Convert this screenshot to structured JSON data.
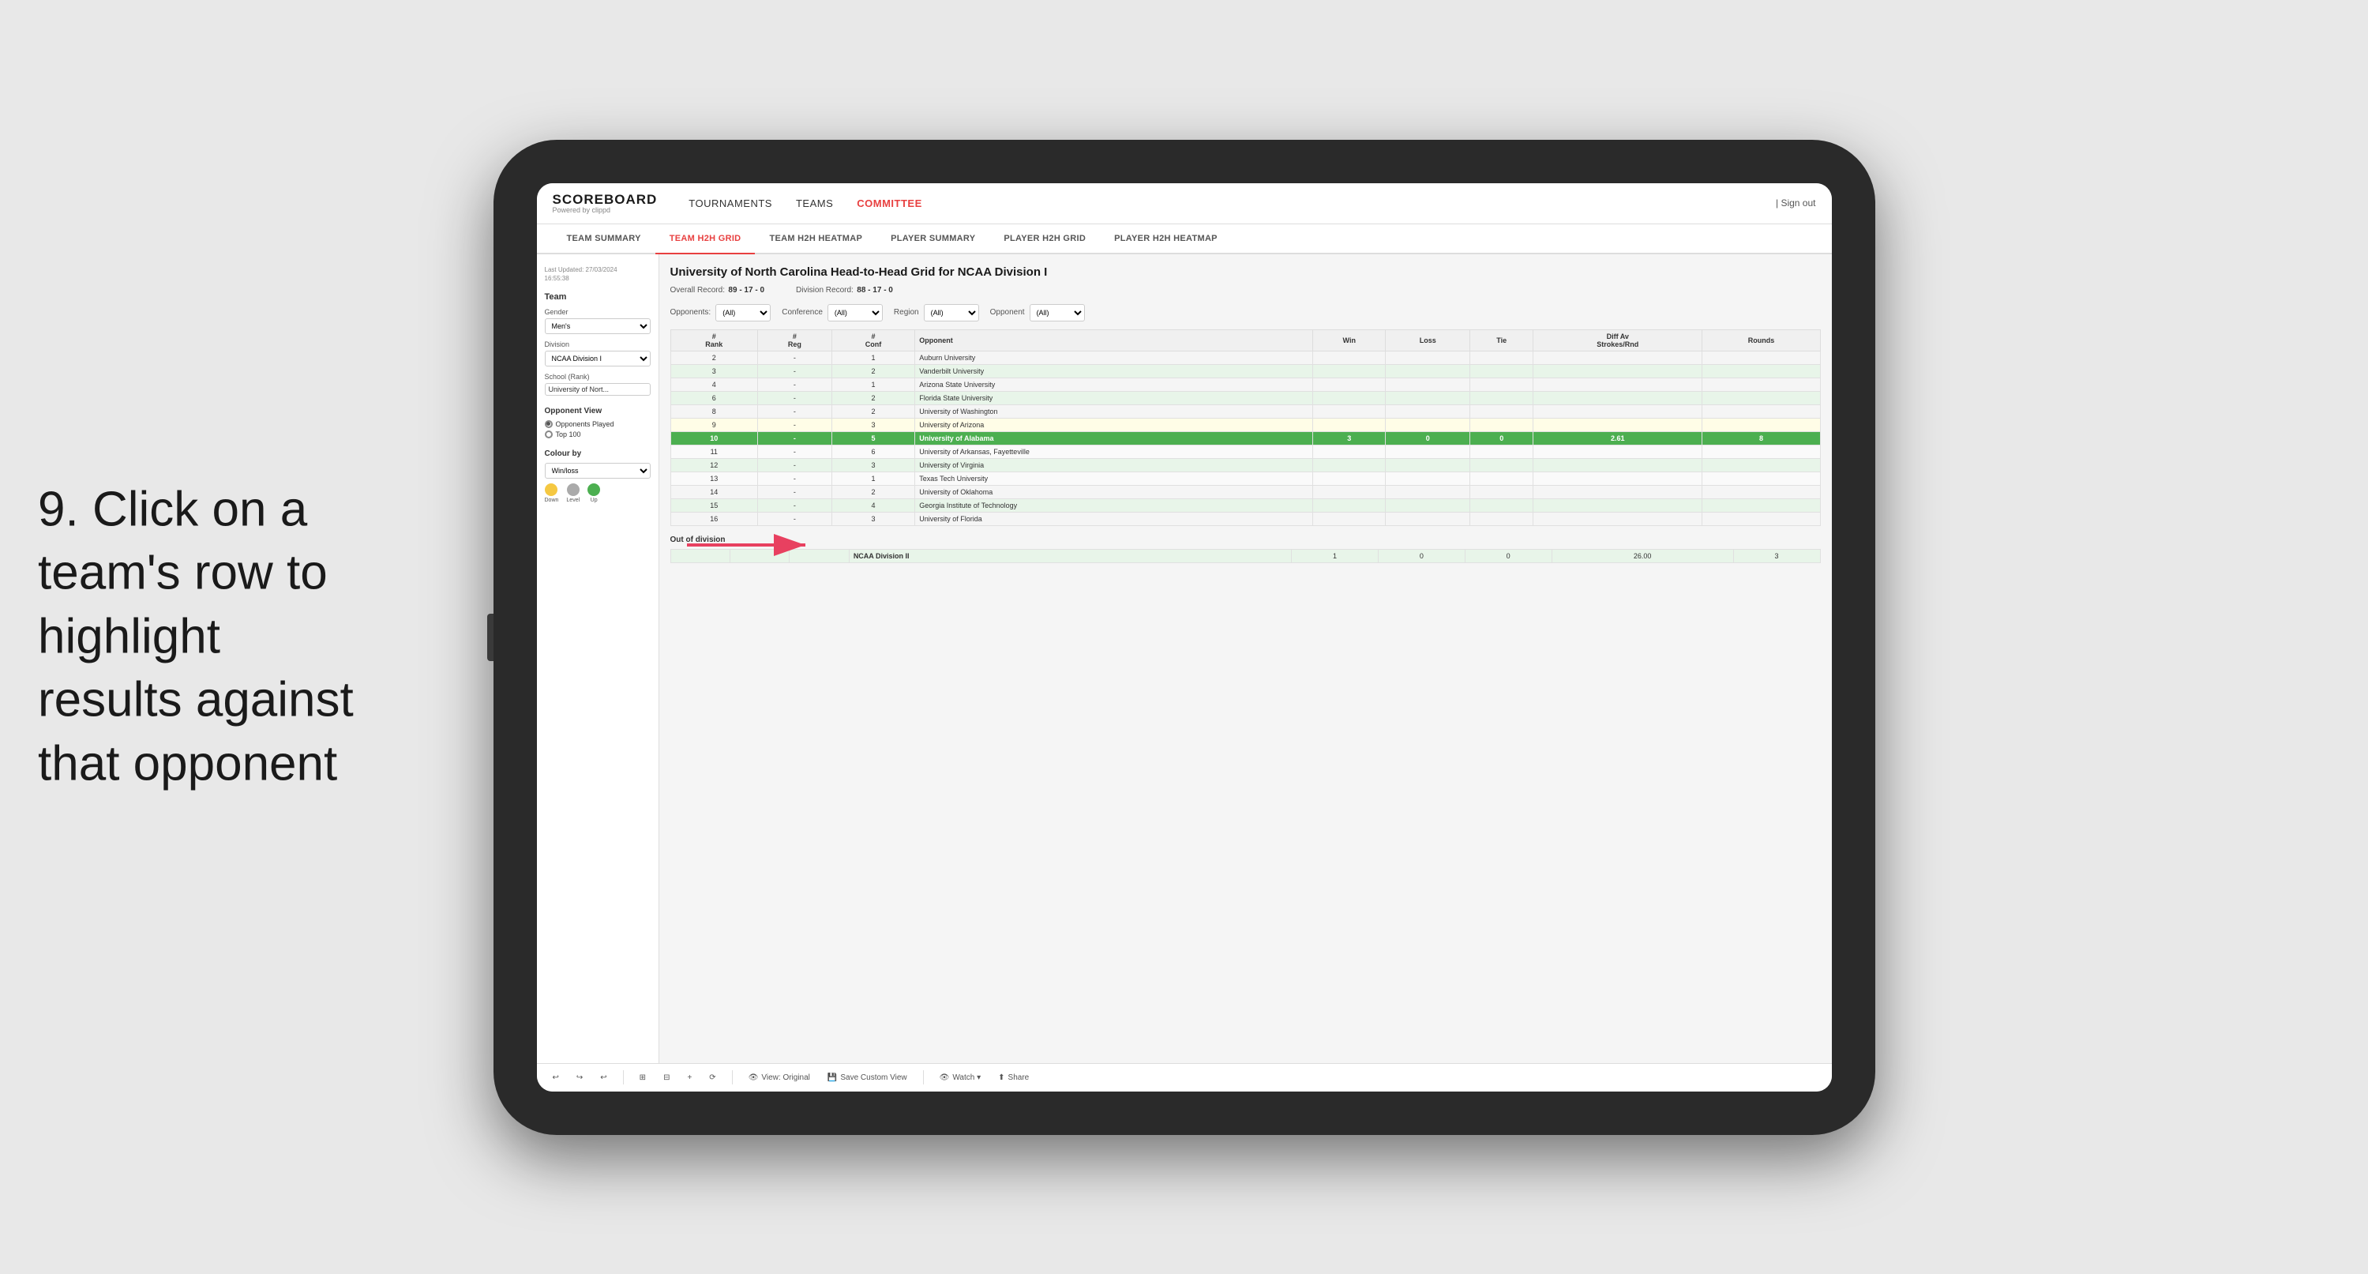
{
  "instruction": {
    "step": "9.",
    "text": "Click on a team's row to highlight results against that opponent"
  },
  "navbar": {
    "logo_title": "SCOREBOARD",
    "logo_sub": "Powered by clippd",
    "nav_tournaments": "TOURNAMENTS",
    "nav_teams": "TEAMS",
    "nav_committee": "COMMITTEE",
    "sign_out": "Sign out"
  },
  "subtabs": [
    {
      "label": "TEAM SUMMARY",
      "active": false
    },
    {
      "label": "TEAM H2H GRID",
      "active": true
    },
    {
      "label": "TEAM H2H HEATMAP",
      "active": false
    },
    {
      "label": "PLAYER SUMMARY",
      "active": false
    },
    {
      "label": "PLAYER H2H GRID",
      "active": false
    },
    {
      "label": "PLAYER H2H HEATMAP",
      "active": false
    }
  ],
  "sidebar": {
    "timestamp_label": "Last Updated: 27/03/2024",
    "timestamp_time": "16:55:38",
    "team_label": "Team",
    "gender_label": "Gender",
    "gender_value": "Men's",
    "division_label": "Division",
    "division_value": "NCAA Division I",
    "school_label": "School (Rank)",
    "school_value": "University of Nort...",
    "opponent_view_title": "Opponent View",
    "radio_opponents_played": "Opponents Played",
    "radio_top100": "Top 100",
    "colour_by_title": "Colour by",
    "colour_by_value": "Win/loss",
    "legend_down": "Down",
    "legend_level": "Level",
    "legend_up": "Up"
  },
  "report": {
    "title": "University of North Carolina Head-to-Head Grid for NCAA Division I",
    "overall_record_label": "Overall Record:",
    "overall_record_value": "89 - 17 - 0",
    "division_record_label": "Division Record:",
    "division_record_value": "88 - 17 - 0",
    "opponents_label": "Opponents:",
    "opponents_value": "(All)",
    "conference_label": "Conference",
    "conference_value": "(All)",
    "region_label": "Region",
    "region_value": "(All)",
    "opponent_label": "Opponent",
    "opponent_value": "(All)",
    "columns": {
      "rank": "#\nRank",
      "reg": "#\nReg",
      "conf": "#\nConf",
      "opponent": "Opponent",
      "win": "Win",
      "loss": "Loss",
      "tie": "Tie",
      "diff_av": "Diff Av\nStrokes/Rnd",
      "rounds": "Rounds"
    }
  },
  "table_rows": [
    {
      "rank": "2",
      "reg": "-",
      "conf": "1",
      "opponent": "Auburn University",
      "win": "",
      "loss": "",
      "tie": "",
      "diff": "",
      "rounds": "",
      "highlight": false,
      "row_class": ""
    },
    {
      "rank": "3",
      "reg": "-",
      "conf": "2",
      "opponent": "Vanderbilt University",
      "win": "",
      "loss": "",
      "tie": "",
      "diff": "",
      "rounds": "",
      "highlight": false,
      "row_class": "green-light"
    },
    {
      "rank": "4",
      "reg": "-",
      "conf": "1",
      "opponent": "Arizona State University",
      "win": "",
      "loss": "",
      "tie": "",
      "diff": "",
      "rounds": "",
      "highlight": false,
      "row_class": ""
    },
    {
      "rank": "6",
      "reg": "-",
      "conf": "2",
      "opponent": "Florida State University",
      "win": "",
      "loss": "",
      "tie": "",
      "diff": "",
      "rounds": "",
      "highlight": false,
      "row_class": "green-light"
    },
    {
      "rank": "8",
      "reg": "-",
      "conf": "2",
      "opponent": "University of Washington",
      "win": "",
      "loss": "",
      "tie": "",
      "diff": "",
      "rounds": "",
      "highlight": false,
      "row_class": ""
    },
    {
      "rank": "9",
      "reg": "-",
      "conf": "3",
      "opponent": "University of Arizona",
      "win": "",
      "loss": "",
      "tie": "",
      "diff": "",
      "rounds": "",
      "highlight": false,
      "row_class": "yellow-light"
    },
    {
      "rank": "10",
      "reg": "-",
      "conf": "5",
      "opponent": "University of Alabama",
      "win": "3",
      "loss": "0",
      "tie": "0",
      "diff": "2.61",
      "rounds": "8",
      "highlight": true,
      "row_class": "highlighted"
    },
    {
      "rank": "11",
      "reg": "-",
      "conf": "6",
      "opponent": "University of Arkansas, Fayetteville",
      "win": "",
      "loss": "",
      "tie": "",
      "diff": "",
      "rounds": "",
      "highlight": false,
      "row_class": ""
    },
    {
      "rank": "12",
      "reg": "-",
      "conf": "3",
      "opponent": "University of Virginia",
      "win": "",
      "loss": "",
      "tie": "",
      "diff": "",
      "rounds": "",
      "highlight": false,
      "row_class": "green-light"
    },
    {
      "rank": "13",
      "reg": "-",
      "conf": "1",
      "opponent": "Texas Tech University",
      "win": "",
      "loss": "",
      "tie": "",
      "diff": "",
      "rounds": "",
      "highlight": false,
      "row_class": ""
    },
    {
      "rank": "14",
      "reg": "-",
      "conf": "2",
      "opponent": "University of Oklahoma",
      "win": "",
      "loss": "",
      "tie": "",
      "diff": "",
      "rounds": "",
      "highlight": false,
      "row_class": ""
    },
    {
      "rank": "15",
      "reg": "-",
      "conf": "4",
      "opponent": "Georgia Institute of Technology",
      "win": "",
      "loss": "",
      "tie": "",
      "diff": "",
      "rounds": "",
      "highlight": false,
      "row_class": "green-light"
    },
    {
      "rank": "16",
      "reg": "-",
      "conf": "3",
      "opponent": "University of Florida",
      "win": "",
      "loss": "",
      "tie": "",
      "diff": "",
      "rounds": "",
      "highlight": false,
      "row_class": ""
    }
  ],
  "out_of_division": {
    "section_label": "Out of division",
    "row": {
      "opponent": "NCAA Division II",
      "win": "1",
      "loss": "0",
      "tie": "0",
      "diff": "26.00",
      "rounds": "3"
    }
  },
  "toolbar": {
    "view_label": "View: Original",
    "save_custom_label": "Save Custom View",
    "watch_label": "Watch ▾",
    "share_label": "Share"
  },
  "colors": {
    "active_tab": "#e84040",
    "highlighted_row": "#4caf50",
    "green_light": "#e8f5e9",
    "yellow_light": "#fffde7",
    "down_color": "#f5c842",
    "level_color": "#aaaaaa",
    "up_color": "#4caf50"
  }
}
